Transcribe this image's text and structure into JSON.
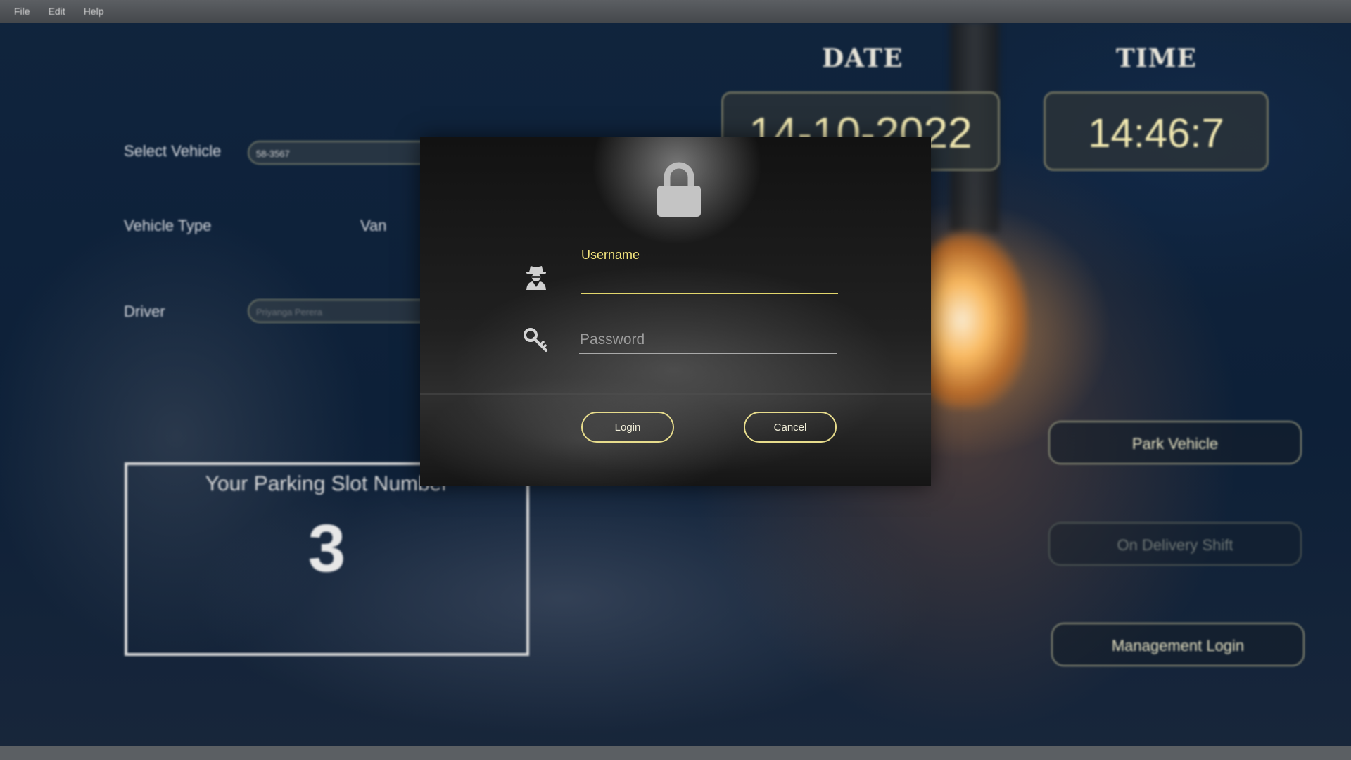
{
  "menubar": {
    "items": [
      "File",
      "Edit",
      "Help"
    ]
  },
  "form": {
    "select_vehicle_label": "Select Vehicle",
    "select_vehicle_value": "58-3567",
    "vehicle_type_label": "Vehicle Type",
    "vehicle_type_value": "Van",
    "driver_label": "Driver",
    "driver_value": "Priyanga Perera"
  },
  "slot": {
    "title": "Your Parking Slot Number",
    "number": "3"
  },
  "datetime": {
    "date_label": "DATE",
    "date_value": "14-10-2022",
    "time_label": "TIME",
    "time_value": "14:46:7"
  },
  "actions": {
    "park": "Park Vehicle",
    "delivery": "On Delivery Shift",
    "management": "Management Login"
  },
  "login_dialog": {
    "username_label": "Username",
    "username_value": "",
    "password_placeholder": "Password",
    "login_button": "Login",
    "cancel_button": "Cancel",
    "icons": {
      "lock": "lock-icon",
      "user": "spy-user-icon",
      "key": "key-icon"
    }
  },
  "colors": {
    "accent": "#e7dc8c",
    "label_yellow": "#f4e57d",
    "background": "#0e2036"
  }
}
